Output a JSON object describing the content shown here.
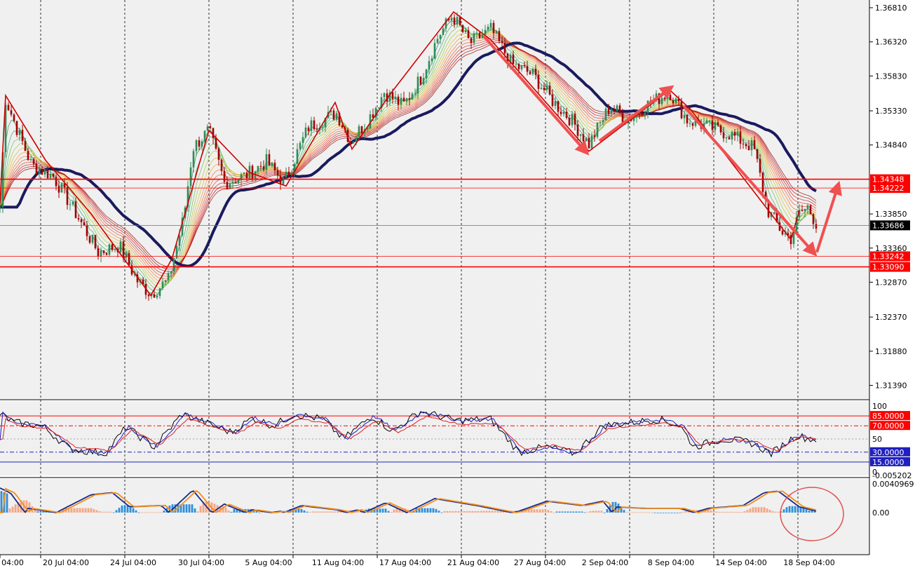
{
  "colors": {
    "background": "#f0f0f0",
    "grid": "#000000",
    "candle_bull": "#2e8b57",
    "candle_bear": "#a00000",
    "slow_ma": "#1a1a5e",
    "zigzag": "#cc0000",
    "level_line": "#ff0000",
    "current_price_line": "#4a6fd6",
    "current_price_label": "#000000",
    "osc_black": "#000000",
    "osc_blue": "#2020c0",
    "osc_red": "#e02020",
    "macd_pos_hist": "#2f8fd8",
    "macd_neg_hist": "#f4a582",
    "macd_main": "#1a2a8a",
    "macd_signal": "#f28e1c",
    "arrow": "#f05050"
  },
  "price_axis": {
    "ticks": [
      "1.36810",
      "1.36320",
      "1.35830",
      "1.35330",
      "1.34840",
      "1.33850",
      "1.33360",
      "1.32870",
      "1.32370",
      "1.31880",
      "1.31390"
    ],
    "levels": [
      {
        "label": "1.34348",
        "value": 1.34348
      },
      {
        "label": "1.34222",
        "value": 1.34222
      },
      {
        "label": "1.33242",
        "value": 1.33242
      },
      {
        "label": "1.33090",
        "value": 1.3309
      }
    ],
    "current": {
      "label": "1.33686",
      "value": 1.33686
    }
  },
  "oscillator": {
    "ticks": [
      "100",
      "50",
      "0"
    ],
    "levels": [
      {
        "label": "85.0000",
        "value": 85
      },
      {
        "label": "70.0000",
        "value": 70
      },
      {
        "label": "30.0000",
        "value": 30
      },
      {
        "label": "15.0000",
        "value": 15
      }
    ]
  },
  "macd": {
    "ticks": [
      "0.0040969",
      "0.00",
      "-0.005202"
    ]
  },
  "time_axis": {
    "labels": [
      "04:00",
      "20 Jul 04:00",
      "24 Jul 04:00",
      "30 Jul 04:00",
      "5 Aug 04:00",
      "11 Aug 04:00",
      "17 Aug 04:00",
      "21 Aug 04:00",
      "27 Aug 04:00",
      "2 Sep 04:00",
      "8 Sep 04:00",
      "14 Sep 04:00",
      "18 Sep 04:00"
    ]
  }
}
